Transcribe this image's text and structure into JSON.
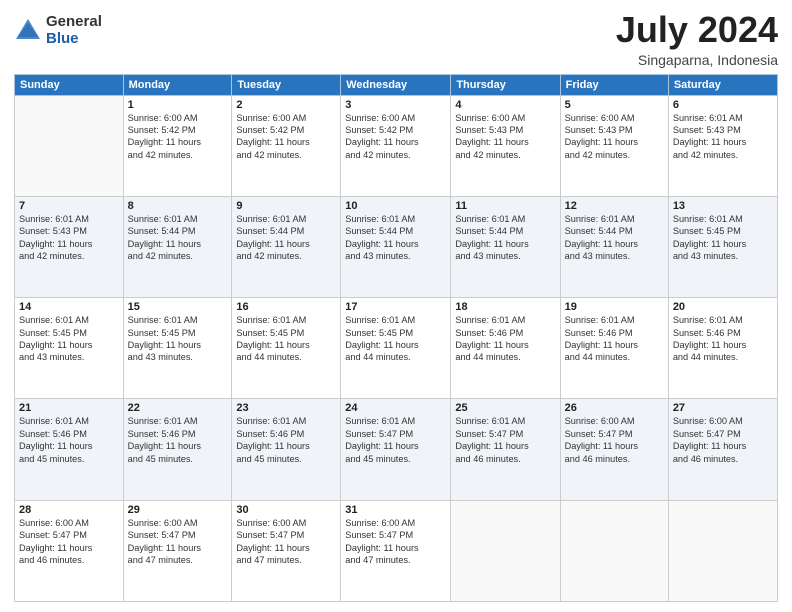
{
  "logo": {
    "general": "General",
    "blue": "Blue"
  },
  "title": "July 2024",
  "subtitle": "Singaparna, Indonesia",
  "headers": [
    "Sunday",
    "Monday",
    "Tuesday",
    "Wednesday",
    "Thursday",
    "Friday",
    "Saturday"
  ],
  "weeks": [
    [
      {
        "day": "",
        "lines": []
      },
      {
        "day": "1",
        "lines": [
          "Sunrise: 6:00 AM",
          "Sunset: 5:42 PM",
          "Daylight: 11 hours",
          "and 42 minutes."
        ]
      },
      {
        "day": "2",
        "lines": [
          "Sunrise: 6:00 AM",
          "Sunset: 5:42 PM",
          "Daylight: 11 hours",
          "and 42 minutes."
        ]
      },
      {
        "day": "3",
        "lines": [
          "Sunrise: 6:00 AM",
          "Sunset: 5:42 PM",
          "Daylight: 11 hours",
          "and 42 minutes."
        ]
      },
      {
        "day": "4",
        "lines": [
          "Sunrise: 6:00 AM",
          "Sunset: 5:43 PM",
          "Daylight: 11 hours",
          "and 42 minutes."
        ]
      },
      {
        "day": "5",
        "lines": [
          "Sunrise: 6:00 AM",
          "Sunset: 5:43 PM",
          "Daylight: 11 hours",
          "and 42 minutes."
        ]
      },
      {
        "day": "6",
        "lines": [
          "Sunrise: 6:01 AM",
          "Sunset: 5:43 PM",
          "Daylight: 11 hours",
          "and 42 minutes."
        ]
      }
    ],
    [
      {
        "day": "7",
        "lines": [
          "Sunrise: 6:01 AM",
          "Sunset: 5:43 PM",
          "Daylight: 11 hours",
          "and 42 minutes."
        ]
      },
      {
        "day": "8",
        "lines": [
          "Sunrise: 6:01 AM",
          "Sunset: 5:44 PM",
          "Daylight: 11 hours",
          "and 42 minutes."
        ]
      },
      {
        "day": "9",
        "lines": [
          "Sunrise: 6:01 AM",
          "Sunset: 5:44 PM",
          "Daylight: 11 hours",
          "and 42 minutes."
        ]
      },
      {
        "day": "10",
        "lines": [
          "Sunrise: 6:01 AM",
          "Sunset: 5:44 PM",
          "Daylight: 11 hours",
          "and 43 minutes."
        ]
      },
      {
        "day": "11",
        "lines": [
          "Sunrise: 6:01 AM",
          "Sunset: 5:44 PM",
          "Daylight: 11 hours",
          "and 43 minutes."
        ]
      },
      {
        "day": "12",
        "lines": [
          "Sunrise: 6:01 AM",
          "Sunset: 5:44 PM",
          "Daylight: 11 hours",
          "and 43 minutes."
        ]
      },
      {
        "day": "13",
        "lines": [
          "Sunrise: 6:01 AM",
          "Sunset: 5:45 PM",
          "Daylight: 11 hours",
          "and 43 minutes."
        ]
      }
    ],
    [
      {
        "day": "14",
        "lines": [
          "Sunrise: 6:01 AM",
          "Sunset: 5:45 PM",
          "Daylight: 11 hours",
          "and 43 minutes."
        ]
      },
      {
        "day": "15",
        "lines": [
          "Sunrise: 6:01 AM",
          "Sunset: 5:45 PM",
          "Daylight: 11 hours",
          "and 43 minutes."
        ]
      },
      {
        "day": "16",
        "lines": [
          "Sunrise: 6:01 AM",
          "Sunset: 5:45 PM",
          "Daylight: 11 hours",
          "and 44 minutes."
        ]
      },
      {
        "day": "17",
        "lines": [
          "Sunrise: 6:01 AM",
          "Sunset: 5:45 PM",
          "Daylight: 11 hours",
          "and 44 minutes."
        ]
      },
      {
        "day": "18",
        "lines": [
          "Sunrise: 6:01 AM",
          "Sunset: 5:46 PM",
          "Daylight: 11 hours",
          "and 44 minutes."
        ]
      },
      {
        "day": "19",
        "lines": [
          "Sunrise: 6:01 AM",
          "Sunset: 5:46 PM",
          "Daylight: 11 hours",
          "and 44 minutes."
        ]
      },
      {
        "day": "20",
        "lines": [
          "Sunrise: 6:01 AM",
          "Sunset: 5:46 PM",
          "Daylight: 11 hours",
          "and 44 minutes."
        ]
      }
    ],
    [
      {
        "day": "21",
        "lines": [
          "Sunrise: 6:01 AM",
          "Sunset: 5:46 PM",
          "Daylight: 11 hours",
          "and 45 minutes."
        ]
      },
      {
        "day": "22",
        "lines": [
          "Sunrise: 6:01 AM",
          "Sunset: 5:46 PM",
          "Daylight: 11 hours",
          "and 45 minutes."
        ]
      },
      {
        "day": "23",
        "lines": [
          "Sunrise: 6:01 AM",
          "Sunset: 5:46 PM",
          "Daylight: 11 hours",
          "and 45 minutes."
        ]
      },
      {
        "day": "24",
        "lines": [
          "Sunrise: 6:01 AM",
          "Sunset: 5:47 PM",
          "Daylight: 11 hours",
          "and 45 minutes."
        ]
      },
      {
        "day": "25",
        "lines": [
          "Sunrise: 6:01 AM",
          "Sunset: 5:47 PM",
          "Daylight: 11 hours",
          "and 46 minutes."
        ]
      },
      {
        "day": "26",
        "lines": [
          "Sunrise: 6:00 AM",
          "Sunset: 5:47 PM",
          "Daylight: 11 hours",
          "and 46 minutes."
        ]
      },
      {
        "day": "27",
        "lines": [
          "Sunrise: 6:00 AM",
          "Sunset: 5:47 PM",
          "Daylight: 11 hours",
          "and 46 minutes."
        ]
      }
    ],
    [
      {
        "day": "28",
        "lines": [
          "Sunrise: 6:00 AM",
          "Sunset: 5:47 PM",
          "Daylight: 11 hours",
          "and 46 minutes."
        ]
      },
      {
        "day": "29",
        "lines": [
          "Sunrise: 6:00 AM",
          "Sunset: 5:47 PM",
          "Daylight: 11 hours",
          "and 47 minutes."
        ]
      },
      {
        "day": "30",
        "lines": [
          "Sunrise: 6:00 AM",
          "Sunset: 5:47 PM",
          "Daylight: 11 hours",
          "and 47 minutes."
        ]
      },
      {
        "day": "31",
        "lines": [
          "Sunrise: 6:00 AM",
          "Sunset: 5:47 PM",
          "Daylight: 11 hours",
          "and 47 minutes."
        ]
      },
      {
        "day": "",
        "lines": []
      },
      {
        "day": "",
        "lines": []
      },
      {
        "day": "",
        "lines": []
      }
    ]
  ]
}
